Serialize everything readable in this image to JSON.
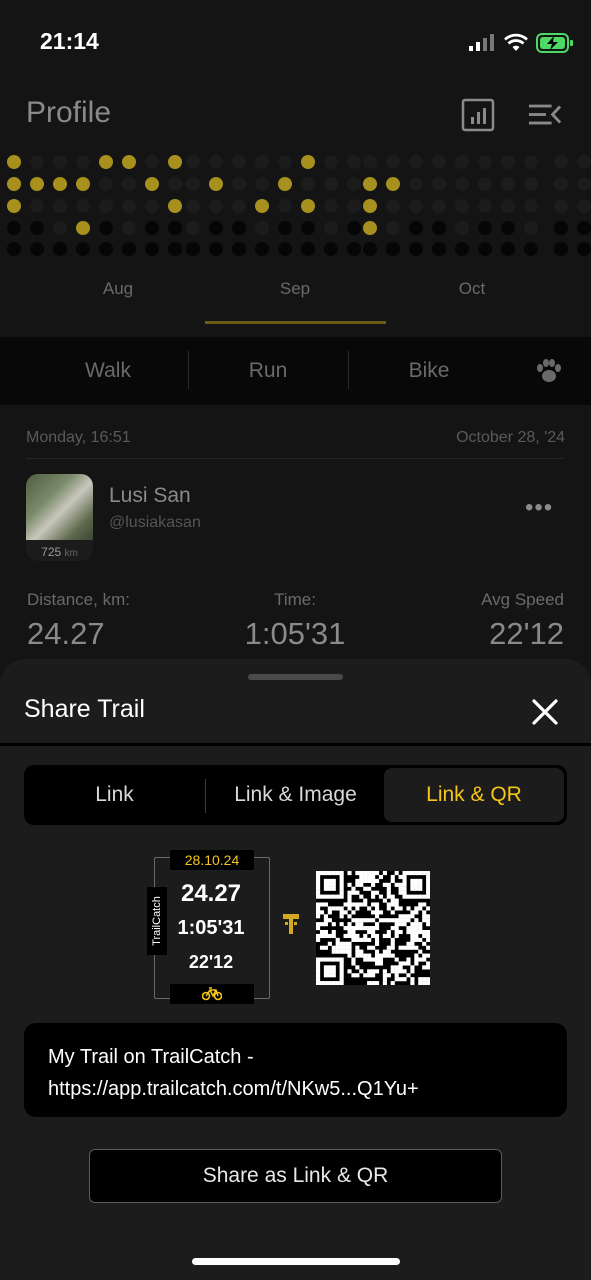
{
  "status_bar": {
    "time": "21:14"
  },
  "header": {
    "title": "Profile",
    "stats_icon": "bar-chart-icon",
    "menu_icon": "menu-collapse-icon"
  },
  "calendar": {
    "months": [
      "Aug",
      "Sep",
      "Oct"
    ],
    "selected_month": "Sep",
    "colors": {
      "active": "#a8901e",
      "inactive": "#1c1c1c",
      "empty": "#060606"
    }
  },
  "activity_tabs": {
    "items": [
      "Walk",
      "Run",
      "Bike"
    ],
    "extra_icon": "paw-icon"
  },
  "activity": {
    "day_time": "Monday, 16:51",
    "date": "October 28, '24",
    "user_name": "Lusi San",
    "user_handle": "@lusiakasan",
    "avatar_km": "725",
    "avatar_km_unit": "km",
    "more_label": "•••",
    "stats": [
      {
        "label": "Distance, km:",
        "value": "24.27"
      },
      {
        "label": "Time:",
        "value": "1:05'31"
      },
      {
        "label": "Avg Speed",
        "value": "22'12"
      }
    ]
  },
  "sheet": {
    "title": "Share Trail",
    "close_icon": "close-icon",
    "segments": [
      "Link",
      "Link & Image",
      "Link & QR"
    ],
    "selected_segment": "Link & QR",
    "card": {
      "date": "28.10.24",
      "brand": "TrailCatch",
      "distance": "24.27",
      "time": "1:05'31",
      "speed": "22'12",
      "sport_icon": "bike-icon"
    },
    "logo_icon": "trailcatch-logo-icon",
    "qr_icon": "qr-code-icon",
    "link_text": "My Trail on TrailCatch - https://app.trailcatch.com/t/NKw5...Q1Yu+",
    "share_button": "Share as Link & QR",
    "accent": "#f5c518"
  }
}
